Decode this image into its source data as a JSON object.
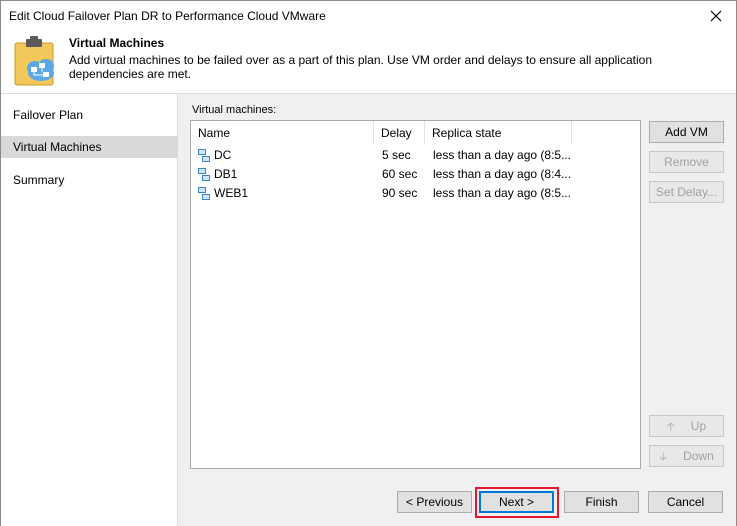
{
  "window": {
    "title": "Edit Cloud Failover Plan DR to Performance Cloud VMware",
    "close_icon": "close-icon"
  },
  "header": {
    "title": "Virtual Machines",
    "description": "Add virtual machines to be failed over as a part of this plan. Use VM order and delays to ensure all application dependencies are met.",
    "icon": "clipboard-cloud-icon"
  },
  "sidebar": {
    "items": [
      {
        "label": "Failover Plan",
        "active": false
      },
      {
        "label": "Virtual Machines",
        "active": true
      },
      {
        "label": "Summary",
        "active": false
      }
    ]
  },
  "vm_table": {
    "label": "Virtual machines:",
    "columns": [
      "Name",
      "Delay",
      "Replica state"
    ],
    "rows": [
      {
        "name": "DC",
        "delay": "5 sec",
        "replica_state": "less than a day ago (8:5..."
      },
      {
        "name": "DB1",
        "delay": "60 sec",
        "replica_state": "less than a day ago (8:4..."
      },
      {
        "name": "WEB1",
        "delay": "90 sec",
        "replica_state": "less than a day ago (8:5..."
      }
    ],
    "row_icon": "vm-icon"
  },
  "actions": {
    "add_vm": "Add VM",
    "remove": "Remove",
    "set_delay": "Set Delay...",
    "up": "Up",
    "down": "Down"
  },
  "footer": {
    "previous": "< Previous",
    "next": "Next >",
    "finish": "Finish",
    "cancel": "Cancel",
    "highlight_color": "#e3182d"
  },
  "colors": {
    "accent": "#0078d7",
    "selected_sidebar": "#d9d9d9",
    "panel_bg": "#f0f0f0",
    "vm_icon": "#3a86c8"
  }
}
